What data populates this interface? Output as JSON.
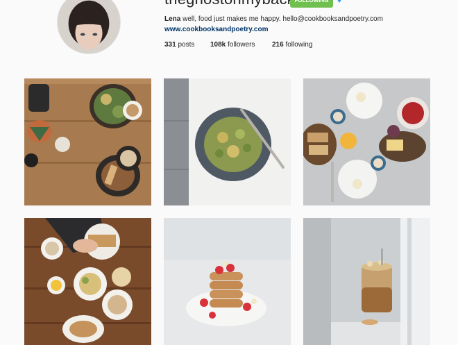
{
  "profile": {
    "username": "theghostonmyback",
    "follow_label": "Following",
    "bio_name": "Lena",
    "bio_text": "well, food just makes me happy. hello@cookbooksandpoetry.com",
    "website": "www.cookbooksandpoetry.com",
    "avatar_icon": "profile-photo",
    "accent_follow": "#70c050",
    "accent_link": "#003569"
  },
  "stats": {
    "posts_count": "331",
    "posts_label": "posts",
    "followers_count": "108k",
    "followers_label": "followers",
    "following_count": "216",
    "following_label": "following"
  },
  "photos": [
    {
      "subject": "breakfast-table-wood"
    },
    {
      "subject": "pasta-bowl-linen"
    },
    {
      "subject": "brunch-spread-marble"
    },
    {
      "subject": "cafe-table-hands"
    },
    {
      "subject": "pancake-stack"
    },
    {
      "subject": "jar-on-windowsill"
    }
  ]
}
